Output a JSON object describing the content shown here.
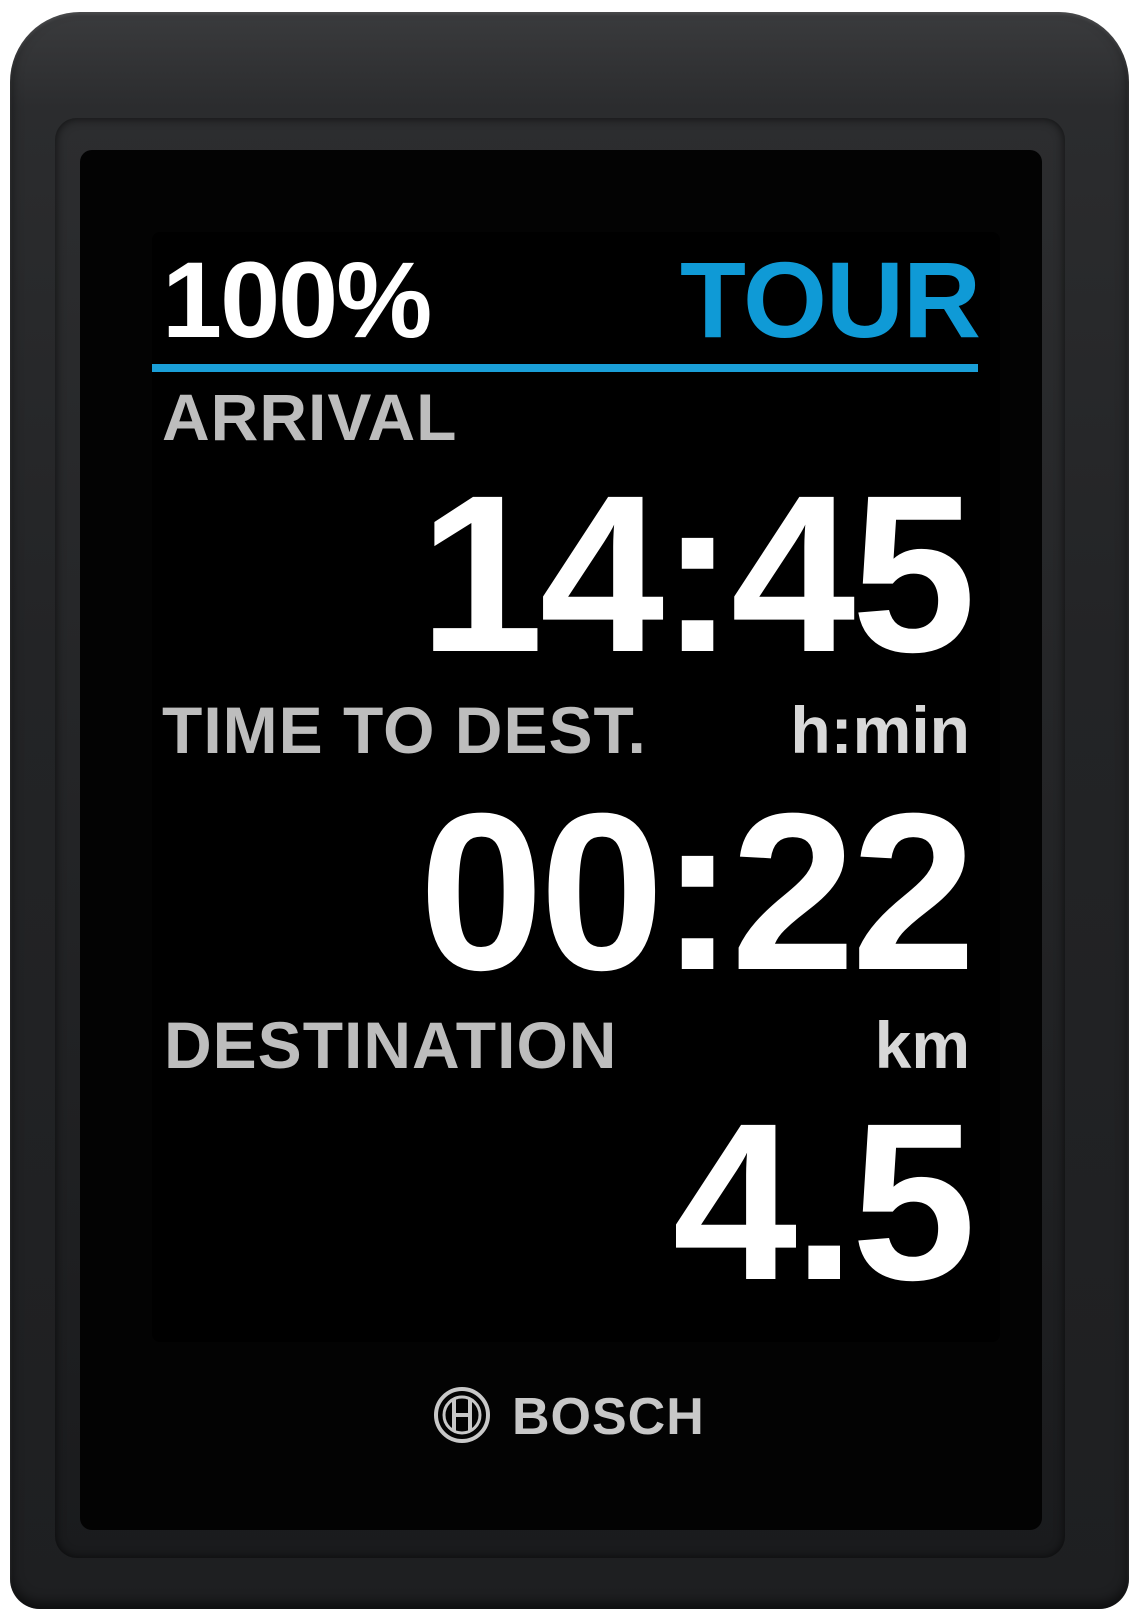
{
  "status": {
    "battery": "100%",
    "mode": "TOUR"
  },
  "fields": [
    {
      "label": "ARRIVAL",
      "unit": "",
      "value": "14:45"
    },
    {
      "label": "TIME TO DEST.",
      "unit": "h:min",
      "value": "00:22"
    },
    {
      "label": "DESTINATION",
      "unit": "km",
      "value": "4.5"
    }
  ],
  "brand": {
    "name": "BOSCH",
    "logo_icon": "bosch-armature-icon"
  },
  "colors": {
    "accent": "#1a9fd8",
    "mode_text": "#0f9ad6",
    "label_text": "#bdbdbd",
    "value_text": "#ffffff",
    "screen_bg": "#000000",
    "housing": "#232426"
  }
}
